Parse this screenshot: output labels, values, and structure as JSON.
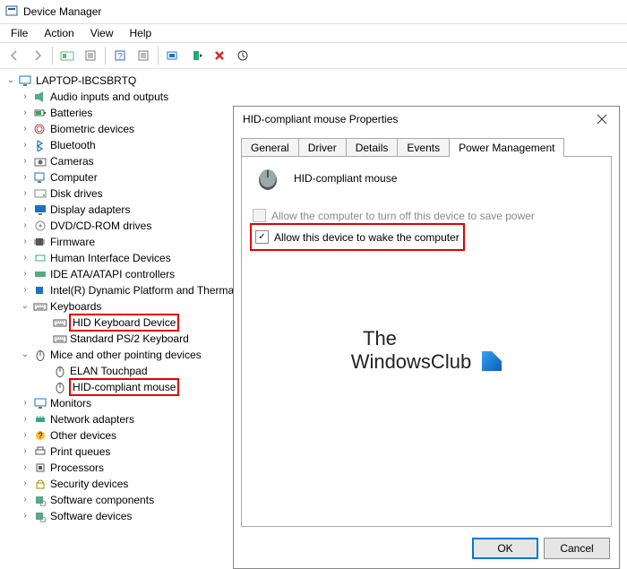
{
  "window": {
    "title": "Device Manager"
  },
  "menu": {
    "file": "File",
    "action": "Action",
    "view": "View",
    "help": "Help"
  },
  "root": "LAPTOP-IBCSBRTQ",
  "nodes": [
    {
      "label": "Audio inputs and outputs",
      "icon": "speaker",
      "exp": ">"
    },
    {
      "label": "Batteries",
      "icon": "battery",
      "exp": ">"
    },
    {
      "label": "Biometric devices",
      "icon": "fingerprint",
      "exp": ">"
    },
    {
      "label": "Bluetooth",
      "icon": "bluetooth",
      "exp": ">"
    },
    {
      "label": "Cameras",
      "icon": "camera",
      "exp": ">"
    },
    {
      "label": "Computer",
      "icon": "computer",
      "exp": ">"
    },
    {
      "label": "Disk drives",
      "icon": "disk",
      "exp": ">"
    },
    {
      "label": "Display adapters",
      "icon": "display",
      "exp": ">"
    },
    {
      "label": "DVD/CD-ROM drives",
      "icon": "dvd",
      "exp": ">"
    },
    {
      "label": "Firmware",
      "icon": "chip",
      "exp": ">"
    },
    {
      "label": "Human Interface Devices",
      "icon": "hid",
      "exp": ">"
    },
    {
      "label": "IDE ATA/ATAPI controllers",
      "icon": "ide",
      "exp": ">"
    },
    {
      "label": "Intel(R) Dynamic Platform and Thermal Framework",
      "icon": "intel",
      "exp": ">"
    },
    {
      "label": "Keyboards",
      "icon": "keyboard",
      "exp": "v",
      "children": [
        {
          "label": "HID Keyboard Device",
          "icon": "keyboard",
          "hl": true
        },
        {
          "label": "Standard PS/2 Keyboard",
          "icon": "keyboard"
        }
      ]
    },
    {
      "label": "Mice and other pointing devices",
      "icon": "mouse",
      "exp": "v",
      "children": [
        {
          "label": "ELAN Touchpad",
          "icon": "mouse"
        },
        {
          "label": "HID-compliant mouse",
          "icon": "mouse",
          "hl": true
        }
      ]
    },
    {
      "label": "Monitors",
      "icon": "monitor",
      "exp": ">"
    },
    {
      "label": "Network adapters",
      "icon": "net",
      "exp": ">"
    },
    {
      "label": "Other devices",
      "icon": "other",
      "exp": ">"
    },
    {
      "label": "Print queues",
      "icon": "printer",
      "exp": ">"
    },
    {
      "label": "Processors",
      "icon": "cpu",
      "exp": ">"
    },
    {
      "label": "Security devices",
      "icon": "lock",
      "exp": ">"
    },
    {
      "label": "Software components",
      "icon": "sw",
      "exp": ">"
    },
    {
      "label": "Software devices",
      "icon": "sw",
      "exp": ">"
    }
  ],
  "dialog": {
    "title": "HID-compliant mouse Properties",
    "tabs": [
      "General",
      "Driver",
      "Details",
      "Events",
      "Power Management"
    ],
    "active_tab": 4,
    "device_name": "HID-compliant mouse",
    "opt1": "Allow the computer to turn off this device to save power",
    "opt2": "Allow this device to wake the computer",
    "ok": "OK",
    "cancel": "Cancel"
  },
  "watermark": {
    "line1": "The",
    "line2": "WindowsClub"
  }
}
